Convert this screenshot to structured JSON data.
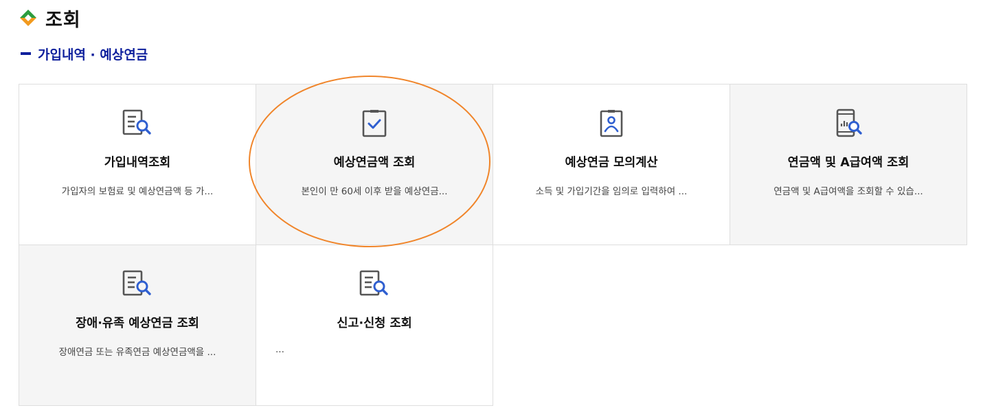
{
  "page": {
    "title": "조회",
    "section_title": "가입내역 · 예상연금"
  },
  "colors": {
    "diamond_top": "#2d9d3f",
    "diamond_bottom": "#f29a1e",
    "section_accent": "#0d1f9c",
    "icon_stroke": "#555555",
    "icon_accent": "#2f5fd0",
    "highlight_ellipse": "#f0852a"
  },
  "cards": [
    {
      "title": "가입내역조회",
      "desc": "가입자의 보험료 및 예상연금액 등 가...",
      "icon": "document-search-icon"
    },
    {
      "title": "예상연금액 조회",
      "desc": "본인이 만 60세 이후 받을 예상연금...",
      "icon": "clipboard-check-icon"
    },
    {
      "title": "예상연금 모의계산",
      "desc": "소득 및 가입기간을 임의로 입력하여 ...",
      "icon": "id-badge-icon"
    },
    {
      "title": "연금액 및 A급여액 조회",
      "desc": "연금액 및 A급여액을 조회할 수 있습...",
      "icon": "phone-chart-search-icon"
    },
    {
      "title": "장애·유족 예상연금 조회",
      "desc": "장애연금 또는 유족연금 예상연금액을 ...",
      "icon": "document-search-icon"
    },
    {
      "title": "신고·신청 조회",
      "desc": "...",
      "icon": "document-search-icon"
    }
  ]
}
